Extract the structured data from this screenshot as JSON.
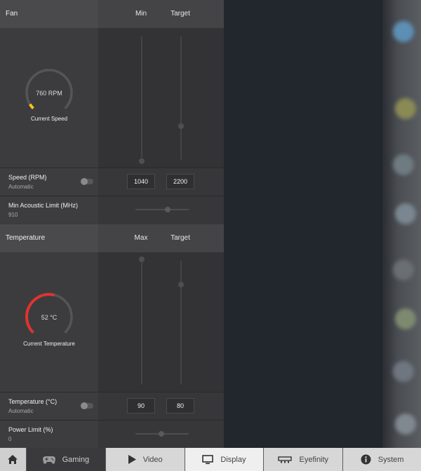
{
  "fan": {
    "title": "Fan",
    "col_min": "Min",
    "col_target": "Target",
    "gauge_value": "760 RPM",
    "gauge_caption": "Current Speed",
    "gauge_fill_fraction": 0.05,
    "gauge_color": "#f5c518",
    "speed_label": "Speed (RPM)",
    "speed_mode": "Automatic",
    "speed_min": "1040",
    "speed_target": "2200",
    "acoustic_label": "Min Acoustic Limit (MHz)",
    "acoustic_value": "910"
  },
  "temperature": {
    "title": "Temperature",
    "col_max": "Max",
    "col_target": "Target",
    "gauge_value": "52 °C",
    "gauge_caption": "Current Temperature",
    "gauge_fill_fraction": 0.55,
    "gauge_color": "#e0332e",
    "temp_label": "Temperature (°C)",
    "temp_mode": "Automatic",
    "temp_max": "90",
    "temp_target": "80",
    "power_label": "Power Limit (%)",
    "power_value": "0"
  },
  "nav": {
    "home_icon": "home-icon",
    "tabs": [
      {
        "label": "Gaming",
        "icon": "gamepad-icon"
      },
      {
        "label": "Video",
        "icon": "play-icon"
      },
      {
        "label": "Display",
        "icon": "monitor-icon"
      },
      {
        "label": "Eyefinity",
        "icon": "eyefinity-icon"
      },
      {
        "label": "System",
        "icon": "info-icon"
      }
    ]
  }
}
